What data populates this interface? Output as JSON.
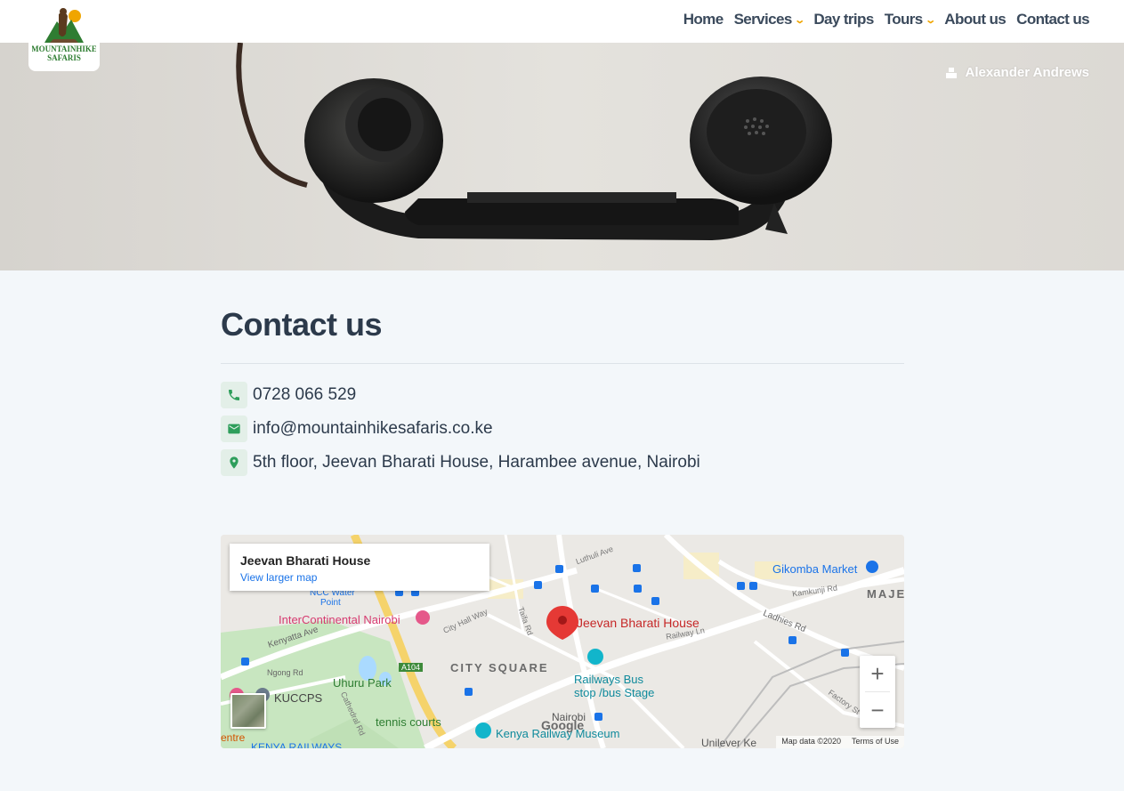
{
  "brand": {
    "logo_line1": "MOUNTAINHIKE",
    "logo_line2": "SAFARIS"
  },
  "nav": {
    "items": [
      {
        "label": "Home",
        "dropdown": false
      },
      {
        "label": "Services",
        "dropdown": true
      },
      {
        "label": "Day trips",
        "dropdown": false
      },
      {
        "label": "Tours",
        "dropdown": true
      },
      {
        "label": "About us",
        "dropdown": false
      },
      {
        "label": "Contact us",
        "dropdown": false
      }
    ]
  },
  "user": {
    "name": "Alexander Andrews"
  },
  "page": {
    "title": "Contact us"
  },
  "contact": {
    "phone": "0728 066 529",
    "email": "info@mountainhikesafaris.co.ke",
    "address": "5th floor, Jeevan Bharati House, Harambee avenue, Nairobi"
  },
  "map": {
    "place_title": "Jeevan Bharati House",
    "larger_map_link": "View larger map",
    "pin_label": "Jeevan Bharati House",
    "labels": {
      "intercontinental": "InterContinental Nairobi",
      "uhuru_park": "Uhuru Park",
      "city_square": "CITY SQUARE",
      "railways_bus": "Railways Bus",
      "bus_stage": "stop /bus Stage",
      "kenya_railway_museum": "Kenya Railway Museum",
      "tennis_courts": "tennis courts",
      "kuccps": "KUCCPS",
      "gikomba_market": "Gikomba Market",
      "majengo": "MAJE",
      "nairobi": "Nairobi",
      "unilever": "Unilever Ke",
      "kenya_railways": "KENYA RAILWAYS",
      "kenyatta_ave": "Kenyatta Ave",
      "ngong_rd": "Ngong Rd",
      "ladhies_rd": "Ladhies Rd",
      "a104": "A104",
      "ncc_water_point": "NCC Water",
      "point": "Point",
      "city_hall_way": "City Hall Way",
      "taifa_rd": "Taifa Rd",
      "luthuli_ave": "Luthuli Ave",
      "railway_ln": "Railway Ln",
      "kamkunji_rd": "Kamkunji Rd",
      "factory_st": "Factory St",
      "cathedral_rd": "Cathedral Rd",
      "centre": "entre"
    },
    "google": "Google",
    "attribution": "Map data ©2020",
    "terms": "Terms of Use",
    "zoom_in": "+",
    "zoom_out": "−"
  },
  "colors": {
    "accent": "#f0a500",
    "text": "#2c3a4b",
    "icon_green": "#2e9e5b",
    "pin_red": "#e53935",
    "link_blue": "#1a73e8"
  },
  "icons": [
    "phone-icon",
    "mail-icon",
    "location-pin-icon",
    "chevron-down-icon",
    "user-icon",
    "map-pin-icon"
  ]
}
